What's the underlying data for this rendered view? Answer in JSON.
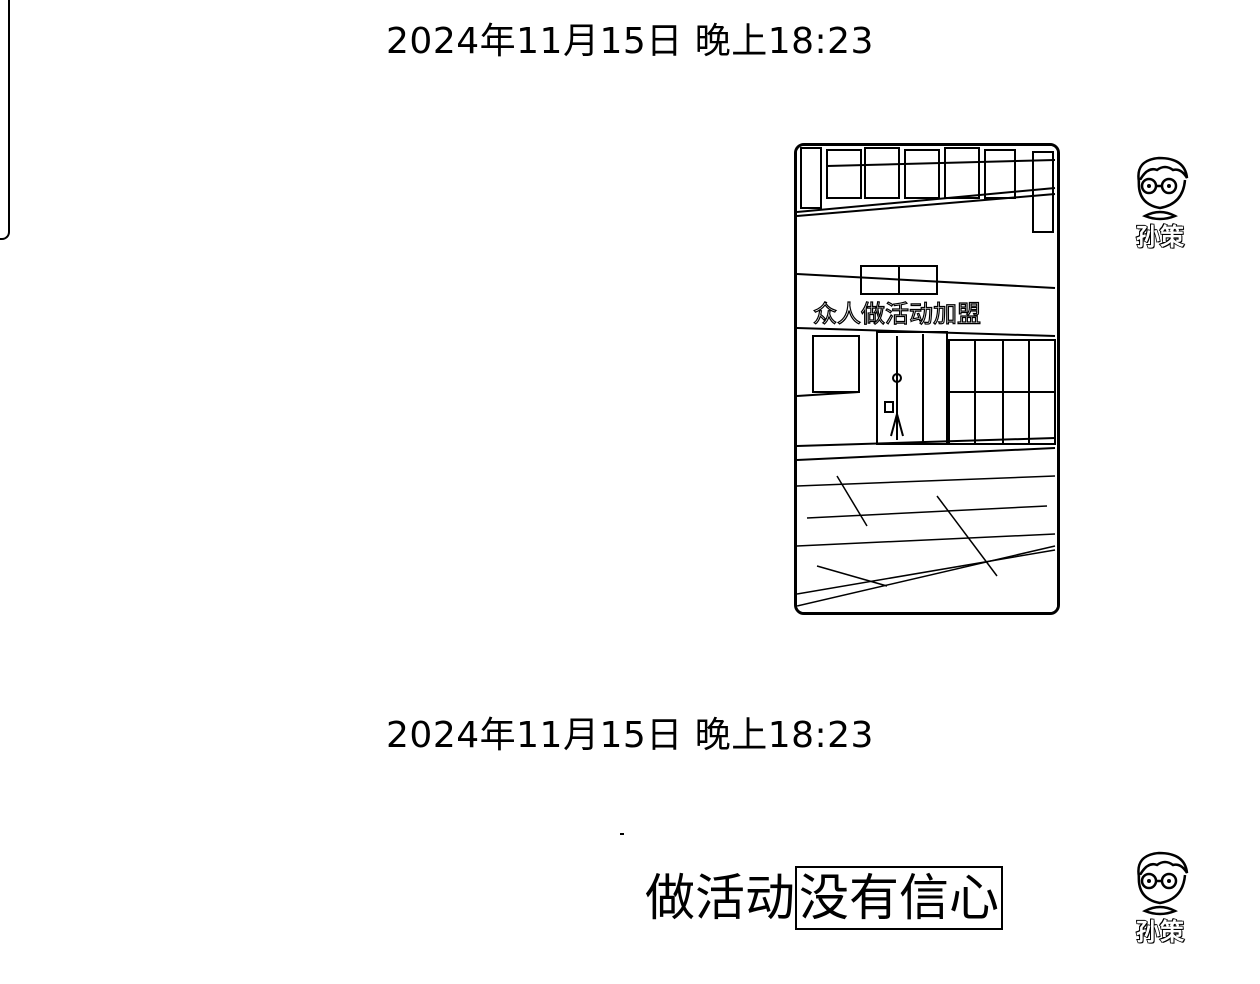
{
  "messages": [
    {
      "timestamp": "2024年11月15日 晚上18:23",
      "type": "image",
      "sender": {
        "avatar_icon": "cartoon-boy-glasses-icon",
        "name": "孙策"
      },
      "image": {
        "subject": "storefront",
        "sign_text": "众人做活动加盟"
      }
    },
    {
      "timestamp": "2024年11月15日 晚上18:23",
      "type": "text",
      "sender": {
        "avatar_icon": "cartoon-boy-glasses-icon",
        "name": "孙策"
      },
      "text_plain": "做活动",
      "text_highlighted": "没有信心"
    }
  ],
  "colors": {
    "background": "#ffffff",
    "ink": "#000000"
  }
}
